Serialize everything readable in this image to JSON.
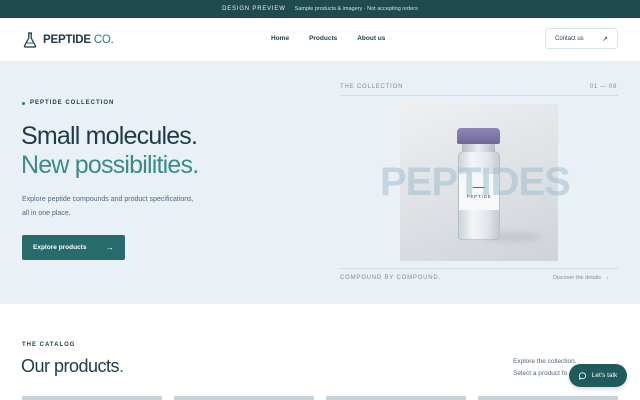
{
  "banner": {
    "label": "DESIGN PREVIEW",
    "note": "Sample products & imagery · Not accepting orders"
  },
  "header": {
    "brand_bold": "PEPTIDE",
    "brand_light": "CO.",
    "nav": [
      "Home",
      "Products",
      "About us"
    ],
    "contact_label": "Contact us"
  },
  "hero": {
    "eyebrow": "PEPTIDE COLLECTION",
    "title_line1": "Small molecules.",
    "title_line2": "New possibilities.",
    "description": "Explore peptide compounds and product specifications, all in one place.",
    "cta_label": "Explore products",
    "collection_label": "THE COLLECTION",
    "collection_count": "01 — 08",
    "vial_label": "PEPTIDE",
    "watermark": "PEPTIDES",
    "compound_caption": "COMPOUND BY COMPOUND.",
    "discover_label": "Discover the details"
  },
  "catalog": {
    "label": "THE CATALOG",
    "title": "Our products",
    "title_dot": ".",
    "side_line1": "Explore the collection.",
    "side_line2": "Select a product fo"
  },
  "chat": {
    "label": "Let's talk"
  },
  "colors": {
    "banner_bg": "#1f4a4f",
    "accent": "#2e7d77",
    "cta_bg": "#276b6d",
    "hero_bg": "#e9f1f6"
  }
}
